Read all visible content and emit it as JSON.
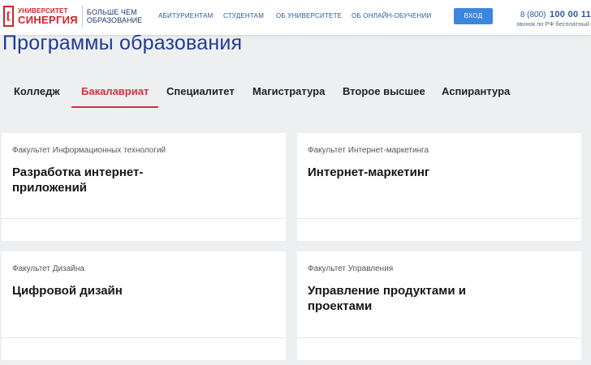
{
  "header": {
    "logo": {
      "line1": "УНИВЕРСИТЕТ",
      "line2": "СИНЕРГИЯ",
      "slogan_line1": "БОЛЬШЕ ЧЕМ",
      "slogan_line2": "ОБРАЗОВАНИЕ",
      "mark": "["
    },
    "nav": [
      "АБИТУРИЕНТАМ",
      "СТУДЕНТАМ",
      "ОБ УНИВЕРСИТЕТЕ",
      "ОБ ОНЛАЙН-ОБУЧЕНИИ"
    ],
    "login_label": "ВХОД",
    "phone_code": "8 (800)",
    "phone_number": "100 00 11",
    "phone_note": "звонок по РФ бесплатный"
  },
  "page_title": "Программы образования",
  "tabs": [
    {
      "label": "Колледж",
      "active": false
    },
    {
      "label": "Бакалавриат",
      "active": true
    },
    {
      "label": "Специалитет",
      "active": false
    },
    {
      "label": "Магистратура",
      "active": false
    },
    {
      "label": "Второе высшее",
      "active": false
    },
    {
      "label": "Аспирантура",
      "active": false
    }
  ],
  "programs": [
    {
      "faculty": "Факультет Информационных технологий",
      "title": "Разработка интернет-приложений"
    },
    {
      "faculty": "Факультет Интернет-маркетинга",
      "title": "Интернет-маркетинг"
    },
    {
      "faculty": "Факультет Дизайна",
      "title": "Цифровой дизайн"
    },
    {
      "faculty": "Факультет Управления",
      "title": "Управление продуктами и проектами"
    }
  ],
  "colors": {
    "brand_red": "#d2232a",
    "title_blue": "#1e3c99",
    "nav_blue": "#2b57a4",
    "button_blue": "#3b86de",
    "active_tab": "#d0333f"
  }
}
